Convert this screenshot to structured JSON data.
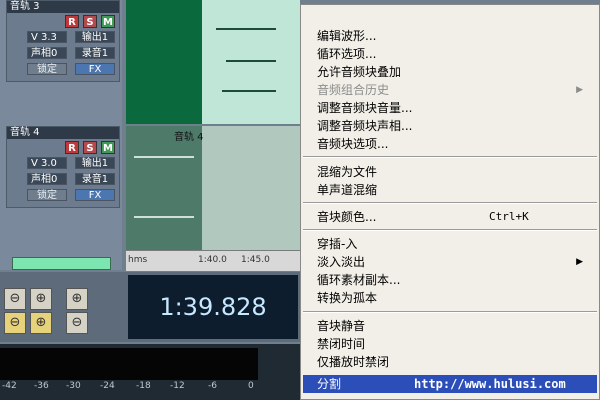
{
  "tracks": [
    {
      "name": "音轨 3",
      "volume": "V 3.3",
      "pan": "声相0",
      "out": "输出1",
      "rec": "录音1",
      "lock": "锁定",
      "fx": "FX"
    },
    {
      "name": "音轨 4",
      "volume": "V 3.0",
      "pan": "声相0",
      "out": "输出1",
      "rec": "录音1",
      "lock": "锁定",
      "fx": "FX"
    }
  ],
  "rsm": {
    "r": "R",
    "s": "S",
    "m": "M"
  },
  "clip_label": "音轨 4",
  "ruler": {
    "unit": "hms",
    "ticks": [
      "1:40.0",
      "1:45.0"
    ]
  },
  "time_display": "1:39.828",
  "meter": {
    "labels": [
      "-42",
      "-36",
      "-30",
      "-24",
      "-18",
      "-12",
      "-6",
      "0"
    ]
  },
  "zoom_icons": [
    "zoom-out-icon",
    "zoom-selection-icon",
    "zoom-in-vertical-icon",
    "zoom-left-icon",
    "zoom-right-icon",
    "zoom-out-vertical-icon"
  ],
  "context_menu": {
    "items": [
      {
        "label": "编辑波形...",
        "disabled": false
      },
      {
        "label": "循环选项...",
        "disabled": false
      },
      {
        "label": "允许音频块叠加",
        "disabled": false
      },
      {
        "label": "音频组合历史",
        "disabled": true,
        "submenu": true
      },
      {
        "label": "调整音频块音量...",
        "disabled": false
      },
      {
        "label": "调整音频块声相...",
        "disabled": false
      },
      {
        "label": "音频块选项...",
        "disabled": false
      },
      {
        "label": "混缩为文件",
        "disabled": false
      },
      {
        "label": "单声道混缩",
        "disabled": false
      },
      {
        "label": "音块颜色...",
        "disabled": false,
        "shortcut": "Ctrl+K"
      },
      {
        "label": "穿插-入",
        "disabled": false
      },
      {
        "label": "淡入淡出",
        "disabled": false,
        "submenu": true
      },
      {
        "label": "循环素材副本...",
        "disabled": false
      },
      {
        "label": "转换为孤本",
        "disabled": false
      },
      {
        "label": "音块静音",
        "disabled": false
      },
      {
        "label": "禁闭时间",
        "disabled": false
      },
      {
        "label": "仅播放时禁闭",
        "disabled": false
      },
      {
        "label": "分割",
        "disabled": false,
        "highlighted": true
      }
    ]
  },
  "watermark": "http://www.hulusi.com",
  "colors": {
    "highlight": "#2c4eb8",
    "track_green": "#0a6a3d",
    "selection": "#bfe6d7"
  }
}
